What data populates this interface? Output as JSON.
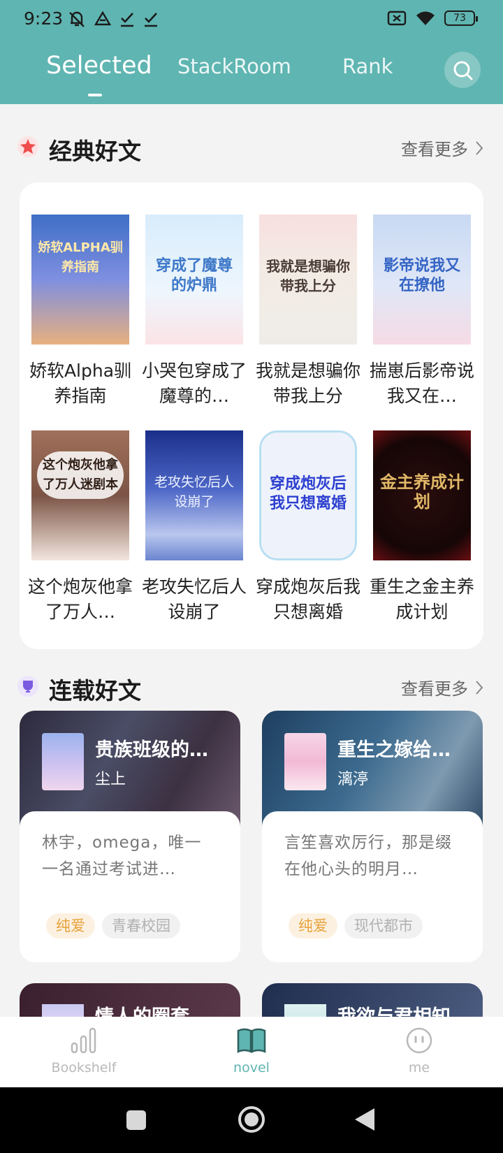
{
  "status": {
    "time": "9:23",
    "battery": "73"
  },
  "tabs": [
    {
      "label": "Selected",
      "active": true
    },
    {
      "label": "StackRoom",
      "active": false
    },
    {
      "label": "Rank",
      "active": false
    }
  ],
  "accent_color": "#5fb5b1",
  "classic": {
    "title": "经典好文",
    "more": "查看更多",
    "books": [
      {
        "title": "娇软Alpha驯养指南",
        "cover_text": "娇软ALPHA驯养指南"
      },
      {
        "title": "小哭包穿成了魔尊的…",
        "cover_text": "穿成了魔尊的炉鼎"
      },
      {
        "title": "我就是想骗你带我上分",
        "cover_text": "我就是想骗你带我上分"
      },
      {
        "title": "揣崽后影帝说我又在…",
        "cover_text": "影帝说我又在撩他"
      },
      {
        "title": "这个炮灰他拿了万人…",
        "cover_text": "这个炮灰他拿了万人迷剧本"
      },
      {
        "title": "老攻失忆后人设崩了",
        "cover_text": "老攻失忆后人设崩了"
      },
      {
        "title": "穿成炮灰后我只想离婚",
        "cover_text": "穿成炮灰后我只想离婚"
      },
      {
        "title": "重生之金主养成计划",
        "cover_text": "金主养成计划"
      }
    ]
  },
  "serial": {
    "title": "连载好文",
    "more": "查看更多",
    "items": [
      {
        "title": "贵族班级的…",
        "author": "尘上",
        "desc": "林宇，omega，唯一一名通过考试进…",
        "tags": [
          "纯爱",
          "青春校园"
        ]
      },
      {
        "title": "重生之嫁给…",
        "author": "漓渟",
        "desc": "言笙喜欢厉行，那是缀在他心头的明月…",
        "tags": [
          "纯爱",
          "现代都市"
        ]
      }
    ],
    "peek": [
      {
        "title": "情人的圈套"
      },
      {
        "title": "我欲与君相知"
      }
    ]
  },
  "nav": [
    {
      "label": "Bookshelf",
      "icon": "bar-chart-icon",
      "active": false
    },
    {
      "label": "novel",
      "icon": "open-book-icon",
      "active": true
    },
    {
      "label": "me",
      "icon": "face-icon",
      "active": false
    }
  ]
}
